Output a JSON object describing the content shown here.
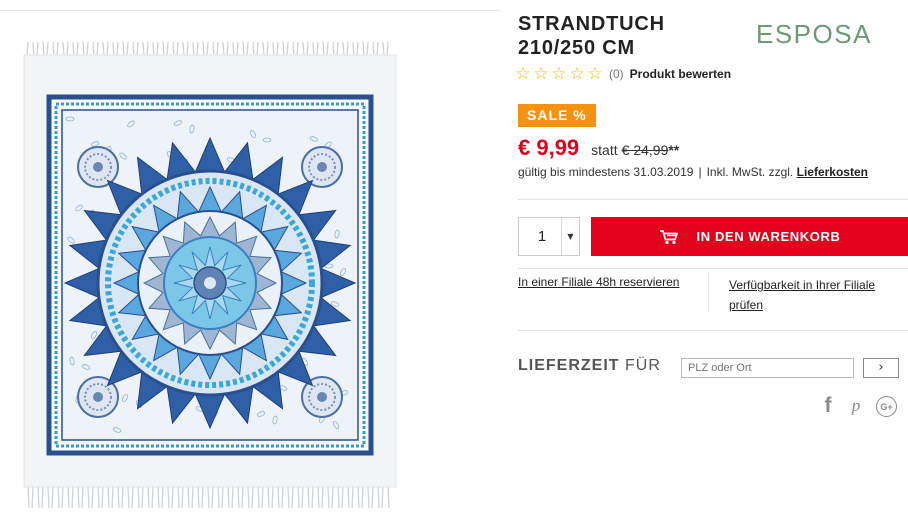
{
  "product": {
    "title": "STRANDTUCH 210/250 CM",
    "brand": "ESPOSA",
    "rating": {
      "stars": [
        "☆",
        "☆",
        "☆",
        "☆",
        "☆"
      ],
      "count": "(0)",
      "rate_link": "Produkt bewerten"
    },
    "sale_badge": "SALE %",
    "price": "€ 9,99",
    "statt_label": "statt",
    "old_price": "€ 24,99",
    "old_price_suffix": "**",
    "validity": "gültig bis mindestens 31.03.2019",
    "validity_sep": "|",
    "tax_note": "Inkl. MwSt. zzgl.",
    "shipping_link": "Lieferkosten"
  },
  "cart": {
    "quantity": "1",
    "add_button": "IN DEN WARENKORB"
  },
  "links": {
    "reserve": "In einer Filiale 48h reservieren",
    "availability": "Verfügbarkeit in Ihrer Filiale prüfen"
  },
  "delivery": {
    "label_bold": "LIEFERZEIT",
    "label_rest": " FÜR",
    "placeholder": "PLZ oder Ort",
    "go_symbol": "›"
  },
  "social": {
    "facebook_glyph": "f",
    "pinterest_glyph": "p",
    "googleplus_glyph": "G+"
  },
  "colors": {
    "accent_red": "#e2001a",
    "sale_orange": "#f5920f",
    "brand_green": "#6c9a76",
    "mandala_blue": "#2f6fb5"
  },
  "icons": {
    "cart": "shopping-cart-icon",
    "qty_dropdown": "triangle-down-icon",
    "go": "chevron-right-icon"
  }
}
